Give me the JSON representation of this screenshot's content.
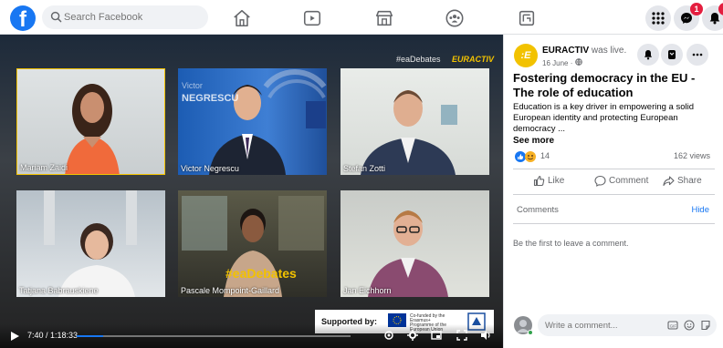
{
  "topbar": {
    "search_placeholder": "Search Facebook",
    "messenger_badge": "1",
    "notifications_badge": "1"
  },
  "video": {
    "hashtag": "#eaDebates",
    "brand_tag": "EURACTIV",
    "participants": [
      {
        "name": "Mariam Zaidi"
      },
      {
        "name": "Victor Negrescu"
      },
      {
        "name": "Stefan Zotti"
      },
      {
        "name": "Tatjana Babrauskiene"
      },
      {
        "name": "Pascale Mompoint-Gaillard"
      },
      {
        "name": "Jan Eichhorn"
      }
    ],
    "backdrop_text": "#eaDebates",
    "supported_label": "Supported by:",
    "eu_note": "Co-funded by the Erasmus+ Programme of the European Union",
    "time": "7:40 / 1:18:33",
    "progress_fraction": 0.098
  },
  "post": {
    "page_name": "EURACTIV",
    "status": "was live.",
    "date": "16 June · ",
    "title": "Fostering democracy in the EU - The role of education",
    "description": "Education is a key driver in empowering a solid European identity and protecting European democracy ...",
    "see_more": "See more",
    "reaction_count": "14",
    "views": "162 views",
    "actions": {
      "like": "Like",
      "comment": "Comment",
      "share": "Share"
    },
    "comments_label": "Comments",
    "hide_label": "Hide",
    "empty_comments": "Be the first to leave a comment.",
    "comment_placeholder": "Write a comment..."
  },
  "colors": {
    "brand": "#1877f2",
    "euractiv": "#f2c200",
    "badge": "#e41e3f"
  }
}
